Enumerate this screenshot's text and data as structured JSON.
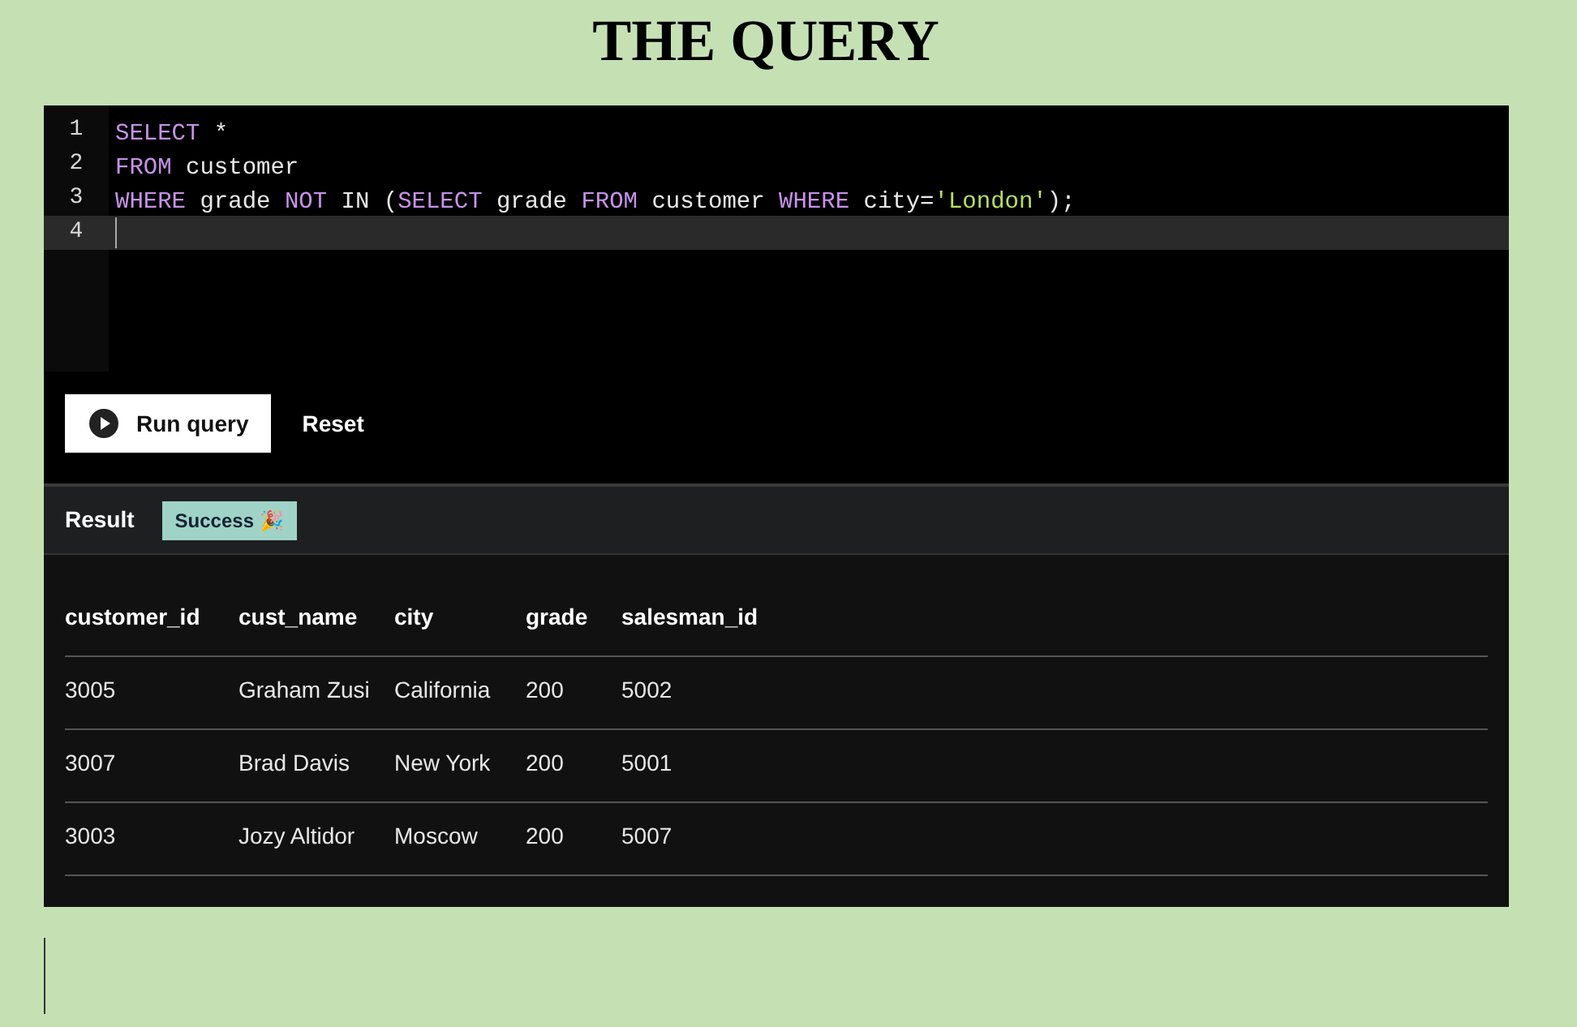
{
  "title": "THE QUERY",
  "editor": {
    "lines": [
      {
        "number": "1",
        "current": false,
        "tokens": [
          {
            "kind": "keyword",
            "text": "SELECT"
          },
          {
            "kind": "plain",
            "text": " *"
          }
        ]
      },
      {
        "number": "2",
        "current": false,
        "tokens": [
          {
            "kind": "keyword",
            "text": "FROM"
          },
          {
            "kind": "plain",
            "text": " customer"
          }
        ]
      },
      {
        "number": "3",
        "current": false,
        "tokens": [
          {
            "kind": "keyword",
            "text": "WHERE"
          },
          {
            "kind": "plain",
            "text": " grade "
          },
          {
            "kind": "keyword",
            "text": "NOT"
          },
          {
            "kind": "plain",
            "text": " IN ("
          },
          {
            "kind": "keyword",
            "text": "SELECT"
          },
          {
            "kind": "plain",
            "text": " grade "
          },
          {
            "kind": "keyword",
            "text": "FROM"
          },
          {
            "kind": "plain",
            "text": " customer "
          },
          {
            "kind": "keyword",
            "text": "WHERE"
          },
          {
            "kind": "plain",
            "text": " city="
          },
          {
            "kind": "string",
            "text": "'London'"
          },
          {
            "kind": "plain",
            "text": ");"
          }
        ]
      },
      {
        "number": "4",
        "current": true
      }
    ]
  },
  "buttons": {
    "run": "Run query",
    "reset": "Reset"
  },
  "result": {
    "label": "Result",
    "status": "Success 🎉"
  },
  "table": {
    "columns": [
      "customer_id",
      "cust_name",
      "city",
      "grade",
      "salesman_id"
    ],
    "rows": [
      [
        "3005",
        "Graham Zusi",
        "California",
        "200",
        "5002"
      ],
      [
        "3007",
        "Brad Davis",
        "New York",
        "200",
        "5001"
      ],
      [
        "3003",
        "Jozy Altidor",
        "Moscow",
        "200",
        "5007"
      ]
    ]
  }
}
